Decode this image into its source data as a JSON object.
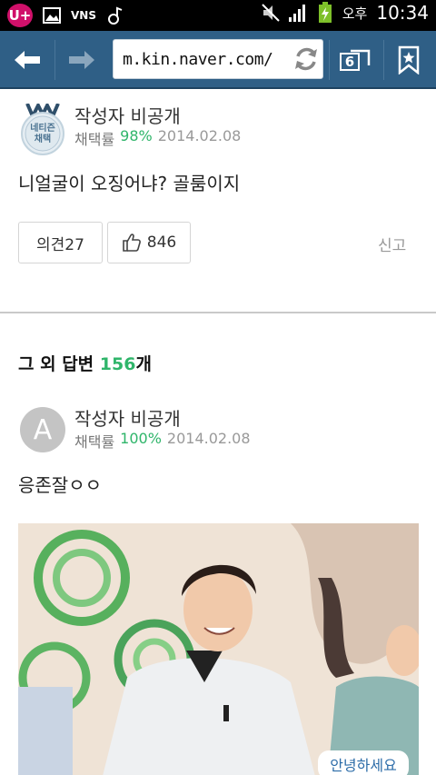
{
  "status_bar": {
    "carrier_logo": "U+",
    "ampm": "오후",
    "time": "10:34",
    "icons": [
      "uplus-icon",
      "image-icon",
      "vns-icon",
      "music-icon",
      "mute-icon",
      "signal-icon",
      "battery-charging-icon"
    ],
    "vns_label": "VNS"
  },
  "browser": {
    "url": "m.kin.naver.com/",
    "tab_count": "6",
    "toolbar_color": "#2f5f86"
  },
  "answer": {
    "badge_line1": "네티즌",
    "badge_line2": "채택",
    "author": "작성자 비공개",
    "adopt_label": "채택률",
    "adopt_rate": "98%",
    "date": "2014.02.08",
    "text": "니얼굴이 오징어냐? 골룸이지",
    "opinion_button": "의견27",
    "like_count": "846",
    "report": "신고"
  },
  "other_answers": {
    "heading_prefix": "그 외 답변 ",
    "count": "156",
    "heading_suffix": "개",
    "first": {
      "avatar_letter": "A",
      "author": "작성자 비공개",
      "adopt_label": "채택률",
      "adopt_rate": "100%",
      "date": "2014.02.08",
      "text": "응존잘ㅇㅇ"
    },
    "photo_caption": "안녕하세요"
  },
  "colors": {
    "accent_green": "#2fb56a",
    "toolbar_blue": "#2f5f86"
  }
}
